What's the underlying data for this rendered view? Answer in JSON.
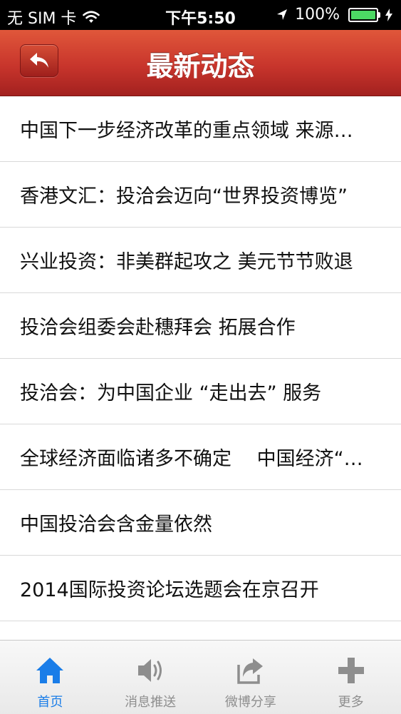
{
  "status_bar": {
    "carrier": "无 SIM 卡",
    "time": "下午5:50",
    "battery": "100%"
  },
  "nav": {
    "title": "最新动态",
    "back_icon": "back-arrow-icon"
  },
  "news": [
    "中国下一步经济改革的重点领域 来源…",
    "香港文汇：投洽会迈向“世界投资博览”",
    "兴业投资：非美群起攻之 美元节节败退",
    "投洽会组委会赴穗拜会 拓展合作",
    "投洽会：为中国企业 “走出去” 服务",
    "全球经济面临诸多不确定　 中国经济“…",
    "中国投洽会含金量依然",
    "2014国际投资论坛选题会在京召开",
    ""
  ],
  "tabs": [
    {
      "label": "首页",
      "icon": "home-icon",
      "active": true
    },
    {
      "label": "消息推送",
      "icon": "speaker-icon",
      "active": false
    },
    {
      "label": "微博分享",
      "icon": "share-icon",
      "active": false
    },
    {
      "label": "更多",
      "icon": "plus-icon",
      "active": false
    }
  ],
  "colors": {
    "nav_red": "#c8352c",
    "active_blue": "#1a7de8",
    "inactive_gray": "#8e8e8e"
  }
}
